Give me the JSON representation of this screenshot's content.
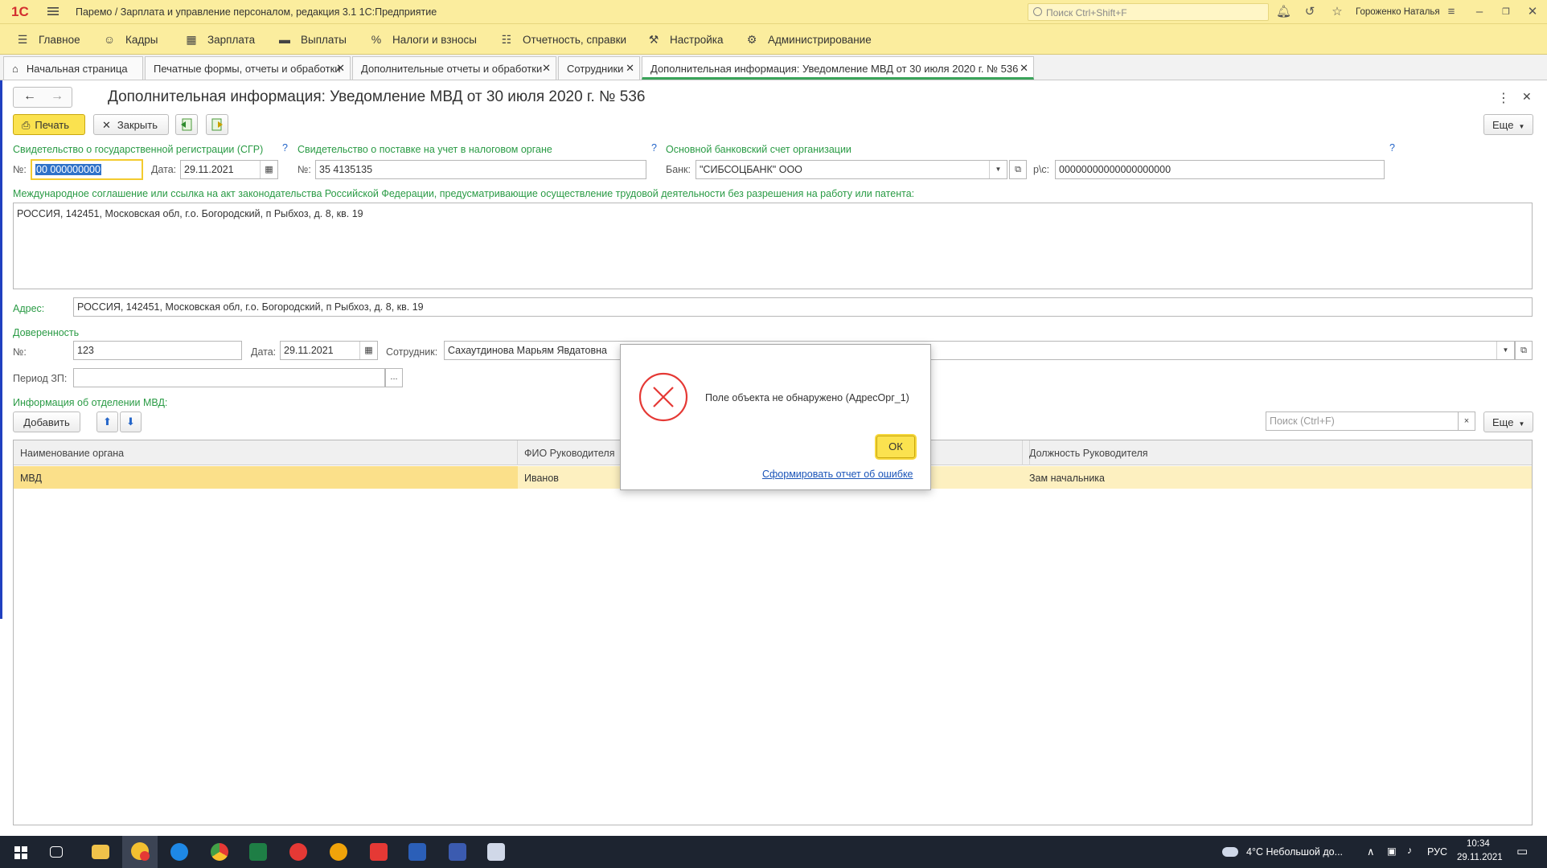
{
  "titlebar": {
    "app_title": "Паремо / Зарплата и управление персоналом, редакция 3.1 1С:Предприятие",
    "search_placeholder": "Поиск Ctrl+Shift+F",
    "user": "Гороженко Наталья",
    "logo_text": "1С"
  },
  "menu": {
    "items": [
      {
        "label": "Главное",
        "icon": "hamburger-icon"
      },
      {
        "label": "Кадры",
        "icon": "people-icon"
      },
      {
        "label": "Зарплата",
        "icon": "calculator-icon"
      },
      {
        "label": "Выплаты",
        "icon": "wallet-icon"
      },
      {
        "label": "Налоги и взносы",
        "icon": "percent-icon"
      },
      {
        "label": "Отчетность, справки",
        "icon": "report-icon"
      },
      {
        "label": "Настройка",
        "icon": "wrench-icon"
      },
      {
        "label": "Администрирование",
        "icon": "gear-icon"
      }
    ]
  },
  "tabs": [
    {
      "label": "Начальная страница"
    },
    {
      "label": "Печатные формы, отчеты и обработки"
    },
    {
      "label": "Дополнительные отчеты и обработки"
    },
    {
      "label": "Сотрудники"
    },
    {
      "label": "Дополнительная информация: Уведомление МВД от 30 июля 2020 г. № 536"
    }
  ],
  "form": {
    "title": "Дополнительная информация: Уведомление МВД от 30 июля 2020 г. № 536",
    "print_label": "Печать",
    "close_label": "Закрыть",
    "more_label": "Еще",
    "sgr_label": "Свидетельство о государственной регистрации (СГР)",
    "num_label": "№:",
    "sgr_number": "00 000000000",
    "date_label": "Дата:",
    "sgr_date": "29.11.2021",
    "tax_label": "Свидетельство о поставке на учет в налоговом органе",
    "tax_number": "35 4135135",
    "bank_section_label": "Основной банковский счет организации",
    "bank_label": "Банк:",
    "bank_value": "\"СИБСОЦБАНК\" ООО",
    "account_label": "р\\с:",
    "account_value": "00000000000000000000",
    "qmark": "?",
    "agreement_label": "Международное соглашение или ссылка на акт законодательства Российской Федерации, предусматривающие осуществление трудовой деятельности без разрешения на работу или патента:",
    "agreement_value": "РОССИЯ, 142451, Московская обл, г.о. Богородский, п Рыбхоз, д. 8, кв. 19",
    "address_label": "Адрес:",
    "address_value": "РОССИЯ, 142451, Московская обл, г.о. Богородский, п Рыбхоз, д. 8, кв. 19",
    "proxy_label": "Доверенность",
    "proxy_number": "123",
    "proxy_date": "29.11.2021",
    "employee_label": "Сотрудник:",
    "employee_value": "Сахаутдинова Марьям Явдатовна",
    "period_label": "Период ЗП:",
    "period_value": "",
    "mvd_info_label": "Информация об отделении МВД:",
    "add_label": "Добавить",
    "search_placeholder": "Поиск (Ctrl+F)",
    "ellipsis": "...",
    "clear_x": "×"
  },
  "table": {
    "columns": [
      "Наименование органа",
      "ФИО Руководителя",
      "",
      "Должность Руководителя"
    ],
    "rows": [
      [
        "МВД",
        "Иванов",
        "",
        "Зам начальника"
      ]
    ]
  },
  "modal": {
    "message": "Поле объекта не обнаружено (АдресОрг_1)",
    "ok_label": "ОК",
    "link_label": "Сформировать отчет об ошибке"
  },
  "taskbar": {
    "weather": "4°C  Небольшой до...",
    "lang": "РУС",
    "time": "10:34",
    "date": "29.11.2021"
  }
}
